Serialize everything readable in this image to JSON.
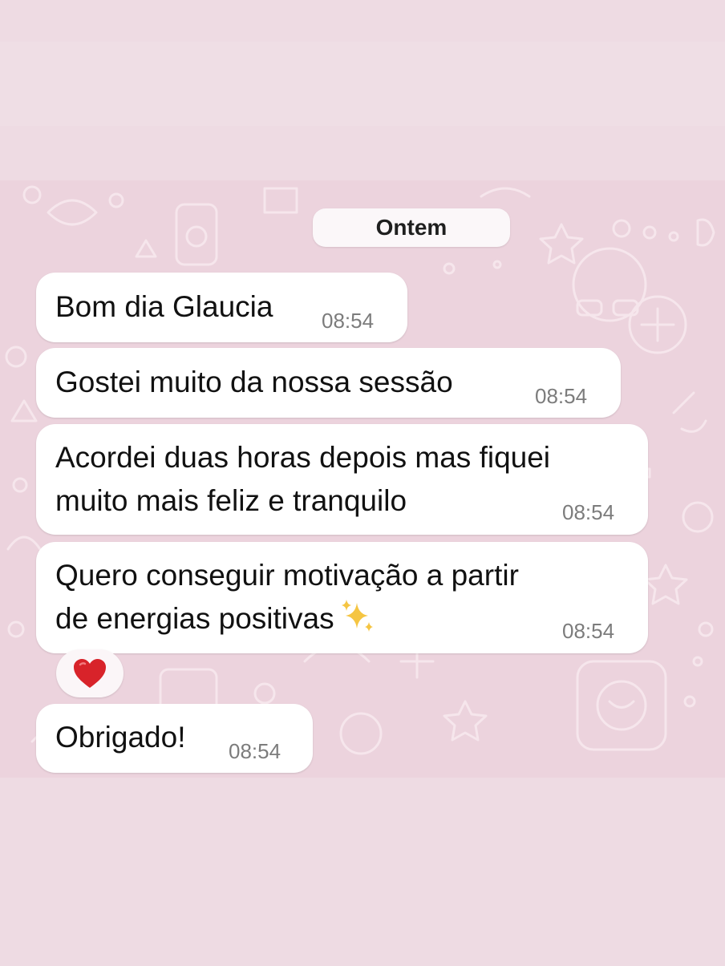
{
  "chat": {
    "date_chip": "Ontem",
    "messages": [
      {
        "text": "Bom dia Glaucia",
        "time": "08:54"
      },
      {
        "text": "Gostei muito da nossa sessão",
        "time": "08:54"
      },
      {
        "line1": "Acordei duas horas depois mas fiquei",
        "line2": "muito mais feliz e tranquilo",
        "time": "08:54"
      },
      {
        "line1": "Quero conseguir motivação a partir",
        "line2": "de energias positivas",
        "time": "08:54",
        "emoji": "sparkles-icon"
      },
      {
        "text": "Obrigado!",
        "time": "08:54"
      }
    ],
    "reaction": "heart-icon"
  },
  "colors": {
    "background": "#eedbe3",
    "chat_wallpaper": "#ecd3dd",
    "bubble": "#ffffff",
    "heart": "#d8232a",
    "sparkle": "#f5c542"
  }
}
